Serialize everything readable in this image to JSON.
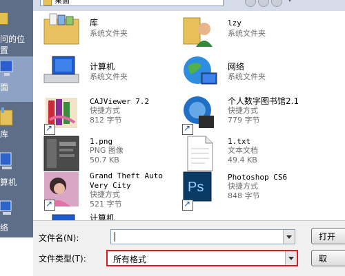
{
  "topbar": {
    "look_in": "桌面"
  },
  "sidebar": {
    "items": [
      {
        "label": "最近访问的位置",
        "label_line1": "问的位",
        "label_line2": "置"
      },
      {
        "label": "桌面",
        "label_short": "面"
      },
      {
        "label": "库",
        "label_short": "库"
      },
      {
        "label": "计算机",
        "label_short": "算机"
      },
      {
        "label": "网络",
        "label_short": "络"
      }
    ]
  },
  "files": [
    {
      "name": "库",
      "meta1": "系统文件夹",
      "meta2": "",
      "icon": "library-folder-icon"
    },
    {
      "name": "lzy",
      "meta1": "系统文件夹",
      "meta2": "",
      "icon": "user-folder-icon"
    },
    {
      "name": "计算机",
      "meta1": "系统文件夹",
      "meta2": "",
      "icon": "computer-icon"
    },
    {
      "name": "网络",
      "meta1": "系统文件夹",
      "meta2": "",
      "icon": "network-globe-icon"
    },
    {
      "name": "CAJViewer 7.2",
      "meta1": "快捷方式",
      "meta2": "812 字节",
      "icon": "cajviewer-icon"
    },
    {
      "name": "个人数字图书馆2.1",
      "meta1": "快捷方式",
      "meta2": "779 字节",
      "icon": "digital-library-icon"
    },
    {
      "name": "1.png",
      "meta1": "PNG 图像",
      "meta2": "50.7 KB",
      "icon": "png-thumbnail-icon"
    },
    {
      "name": "1.txt",
      "meta1": "文本文档",
      "meta2": "49.4 KB",
      "icon": "text-document-icon"
    },
    {
      "name": "Grand Theft Auto",
      "name2": "Very City",
      "meta1": "快捷方式",
      "meta2": "521 字节",
      "icon": "gta-icon"
    },
    {
      "name": "Photoshop CS6",
      "meta1": "快捷方式",
      "meta2": "848 字节",
      "icon": "photoshop-icon"
    },
    {
      "name": "计算机",
      "meta1": "",
      "meta2": "",
      "icon": "computer-icon"
    }
  ],
  "bottom": {
    "filename_label": "文件名(N):",
    "filename_value": "",
    "filetype_label": "文件类型(T):",
    "filetype_value": "所有格式",
    "open_label": "打开",
    "cancel_label": "取"
  },
  "colors": {
    "sidebar": "#5e6e88",
    "highlight": "#e0191f",
    "ps_blue": "#0a3a66"
  }
}
